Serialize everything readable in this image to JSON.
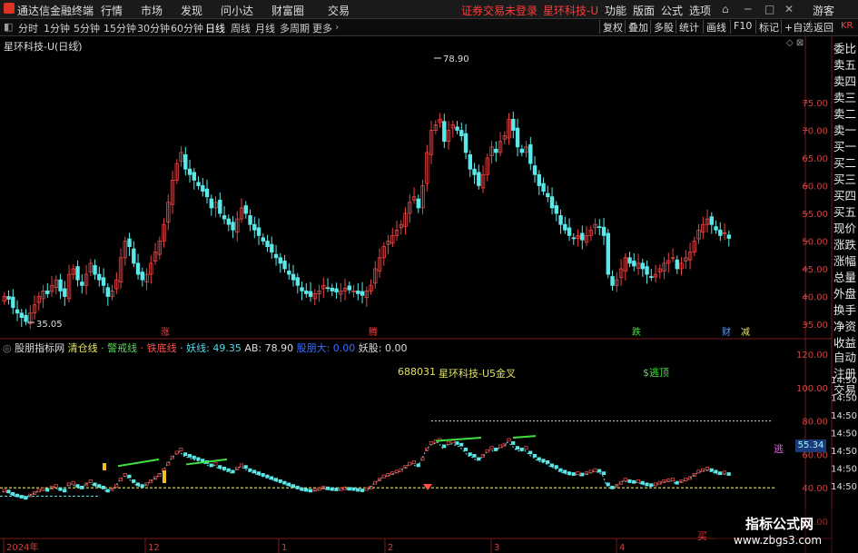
{
  "app_title": "通达信金融终端",
  "menu": [
    "行情",
    "市场",
    "发现",
    "问小达",
    "财富圈",
    "交易"
  ],
  "menu_right": [
    "功能",
    "版面",
    "公式",
    "选项"
  ],
  "alert": "证券交易未登录",
  "stock_title": "星环科技-U",
  "guest": "游客",
  "periods": [
    "分时",
    "1分钟",
    "5分钟",
    "15分钟",
    "30分钟",
    "60分钟",
    "日线",
    "周线",
    "月线",
    "多周期",
    "更多"
  ],
  "active_period": "日线",
  "toolbar_buttons": [
    "复权",
    "叠加",
    "多股",
    "统计",
    "画线",
    "F10",
    "标记",
    "+自选",
    "返回"
  ],
  "main_label": "星环科技-U(日线)",
  "price_ticks": [
    "75.00",
    "70.00",
    "65.00",
    "60.00",
    "55.00",
    "50.00",
    "45.00",
    "40.00",
    "35.00"
  ],
  "high_label": "78.90",
  "low_label": "35.05",
  "markers": {
    "zhang": "涨",
    "teng": "腾",
    "die": "跌",
    "cai": "财",
    "jian": "减"
  },
  "indicator": {
    "name": "股朋指标网",
    "qingcang": "清仓线",
    "jingjie": "警戒线",
    "tiedi": "铁底线",
    "yao_label": "妖线:",
    "yao_value": "49.35",
    "ab_label": "AB:",
    "ab_value": "78.90",
    "jiuchuan": "股朋大: 0.00",
    "yaogu": "妖股: 0.00",
    "code": "688031",
    "stock": "星环科技-U5金叉",
    "signal": "$逃顶",
    "current_value": "55.34",
    "tao": "逃",
    "mai": "买"
  },
  "ind_ticks": [
    "120.00",
    "100.00",
    "80.00",
    "60.00",
    "40.00",
    "20.00"
  ],
  "time_ticks": [
    "14:50",
    "14:50",
    "14:50",
    "14:50",
    "14:50",
    "14:50",
    "14:50"
  ],
  "date_labels": [
    "2024年",
    "12",
    "1",
    "2",
    "3",
    "4"
  ],
  "sidebar": [
    "委比",
    "卖五",
    "卖四",
    "卖三",
    "卖二",
    "卖一",
    "买一",
    "买二",
    "买三",
    "买四",
    "买五",
    "现价",
    "涨跌",
    "涨幅",
    "总量",
    "外盘",
    "换手",
    "净资",
    "收益"
  ],
  "sidebar2": [
    "自动",
    "注册",
    "交易"
  ],
  "kr_label": "KR",
  "watermark": {
    "line1": "指标公式网",
    "line2": "www.zbgs3.com"
  }
}
